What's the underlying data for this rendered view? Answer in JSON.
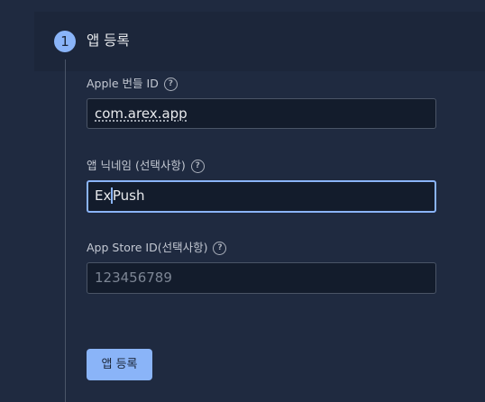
{
  "step": {
    "number": "1",
    "title": "앱 등록"
  },
  "fields": {
    "bundle_id": {
      "label": "Apple 번들 ID",
      "value": "com.arex.app"
    },
    "nickname": {
      "label": "앱 닉네임 (선택사항)",
      "value_before_caret": "Ex",
      "value_after_caret": "Push"
    },
    "app_store_id": {
      "label": "App Store ID(선택사항)",
      "placeholder": "123456789"
    }
  },
  "help_icon_glyph": "?",
  "actions": {
    "register_label": "앱 등록"
  }
}
